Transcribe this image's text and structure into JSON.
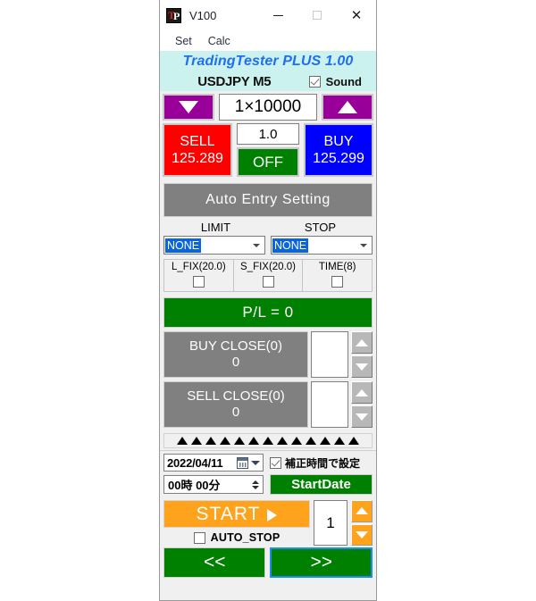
{
  "window": {
    "title": "V100",
    "icon": "tp-logo-icon",
    "controls": {
      "minimize": "minimize-icon",
      "maximize": "maximize-icon",
      "close": "close-icon"
    }
  },
  "menubar": {
    "items": [
      {
        "label": "Set"
      },
      {
        "label": "Calc"
      }
    ]
  },
  "banner": {
    "text": "TradingTester PLUS 1.00",
    "bg_color": "#CCF2EF",
    "text_color": "#1F6FF0"
  },
  "symbol_row": {
    "symbol": "USDJPY M5",
    "sound_label": "Sound",
    "sound_checked": true
  },
  "lot_row": {
    "decrease_icon": "triangle-down-icon",
    "increase_icon": "triangle-up-icon",
    "lot_value": "1×10000",
    "button_color": "#990099"
  },
  "trade_row": {
    "sell": {
      "label": "SELL",
      "price": "125.289",
      "color": "#FF0000"
    },
    "buy": {
      "label": "BUY",
      "price": "125.299",
      "color": "#0000FF"
    },
    "amount": "1.0",
    "toggle_label": "OFF",
    "toggle_color": "#008000"
  },
  "auto_entry": {
    "label": "Auto Entry Setting",
    "color": "#808080"
  },
  "order_settings": {
    "limit_label": "LIMIT",
    "stop_label": "STOP",
    "limit_value": "NONE",
    "stop_value": "NONE",
    "fix_cells": [
      {
        "label": "L_FIX(20.0)",
        "checked": false
      },
      {
        "label": "S_FIX(20.0)",
        "checked": false
      },
      {
        "label": "TIME(8)",
        "checked": false
      }
    ]
  },
  "pl": {
    "label": "P/L =  0",
    "color": "#008000"
  },
  "close_rows": [
    {
      "label": "BUY CLOSE(0)",
      "value": "0",
      "field_value": "",
      "up_icon": "triangle-up-icon",
      "down_icon": "triangle-down-icon"
    },
    {
      "label": "SELL CLOSE(0)",
      "value": "0",
      "field_value": "",
      "up_icon": "triangle-up-icon",
      "down_icon": "triangle-down-icon"
    }
  ],
  "grip": {
    "icon": "resize-grip-icon",
    "marker_count": 13
  },
  "date_section": {
    "date_value": "2022/04/11",
    "calendar_icon": "calendar-icon",
    "dropdown_icon": "chevron-down-icon",
    "correction_label": "補正時間で設定",
    "correction_checked": true,
    "time_value": "00時 00分",
    "time_spinner_icon": "spinner-icon",
    "startdate_label": "StartDate",
    "startdate_color": "#008000"
  },
  "start_section": {
    "start_label": "START",
    "start_icon": "play-icon",
    "start_color": "#FFA21C",
    "autostop_label": "AUTO_STOP",
    "autostop_checked": false,
    "count_value": "1",
    "up_icon": "triangle-up-icon",
    "down_icon": "triangle-down-icon"
  },
  "nav": {
    "prev_label": "<<",
    "next_label": ">>",
    "color": "#008000",
    "focus_color": "#1B8CF0"
  }
}
